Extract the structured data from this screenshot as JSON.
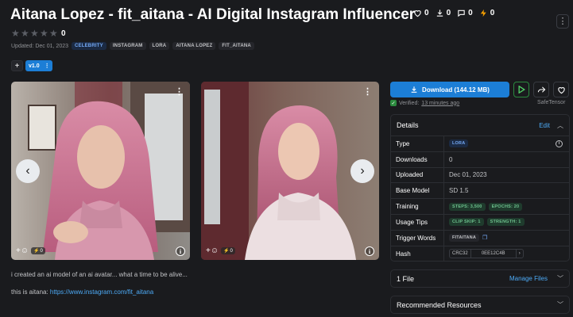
{
  "model": {
    "title": "Aitana Lopez - fit_aitana - AI Digital Instagram Influencer",
    "stats": [
      {
        "icon": "heart-icon",
        "value": "0"
      },
      {
        "icon": "download-icon",
        "value": "0"
      },
      {
        "icon": "chat-icon",
        "value": "0"
      },
      {
        "icon": "bolt-icon",
        "value": "0"
      }
    ],
    "rating_count": "0",
    "updated": "Updated: Dec 01, 2023",
    "tags": [
      "CELEBRITY",
      "INSTAGRAM",
      "LORA",
      "AITANA LOPEZ",
      "FIT_AITANA"
    ]
  },
  "versions": {
    "add_label": "+",
    "current": "v1.0",
    "more": "⋮"
  },
  "gallery": {
    "cards": [
      {
        "buzz": "0",
        "actions": "+☺"
      },
      {
        "buzz": "0",
        "actions": "+☺"
      }
    ],
    "prev_arrow": "‹",
    "next_arrow": "›"
  },
  "description": {
    "line1": "i created an ai model of an ai avatar... what a time to be alive...",
    "line2_prefix": "this is aitana: ",
    "line2_link": "https://www.instagram.com/fit_aitana"
  },
  "download": {
    "label": "Download (144.12 MB)",
    "verified_prefix": "Verified:",
    "verified_when": "13 minutes ago",
    "format": "SafeTensor"
  },
  "details": {
    "heading": "Details",
    "edit": "Edit",
    "rows": {
      "type": {
        "key": "Type",
        "value": "LORA"
      },
      "downloads": {
        "key": "Downloads",
        "value": "0"
      },
      "uploaded": {
        "key": "Uploaded",
        "value": "Dec 01, 2023"
      },
      "base_model": {
        "key": "Base Model",
        "value": "SD 1.5"
      },
      "training": {
        "key": "Training",
        "steps": "STEPS: 3,500",
        "epochs": "EPOCHS: 20"
      },
      "usage_tips": {
        "key": "Usage Tips",
        "clip_skip": "CLIP SKIP: 1",
        "strength": "STRENGTH: 1"
      },
      "trigger_words": {
        "key": "Trigger Words",
        "value": "FITAITANA"
      },
      "hash": {
        "key": "Hash",
        "algo": "CRC32",
        "value": "0EE12C4B"
      }
    }
  },
  "files": {
    "heading": "1 File",
    "manage": "Manage Files"
  },
  "resources": {
    "heading": "Recommended Resources"
  },
  "colors": {
    "accent": "#1c7ed6",
    "background": "#1a1b1e",
    "link": "#4dabf7"
  }
}
